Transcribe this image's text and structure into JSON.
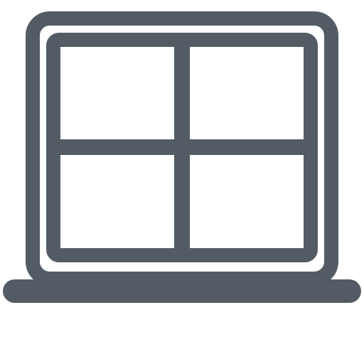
{
  "icon": {
    "name": "window-icon",
    "color": "#535c65",
    "background": "#ffffff"
  }
}
